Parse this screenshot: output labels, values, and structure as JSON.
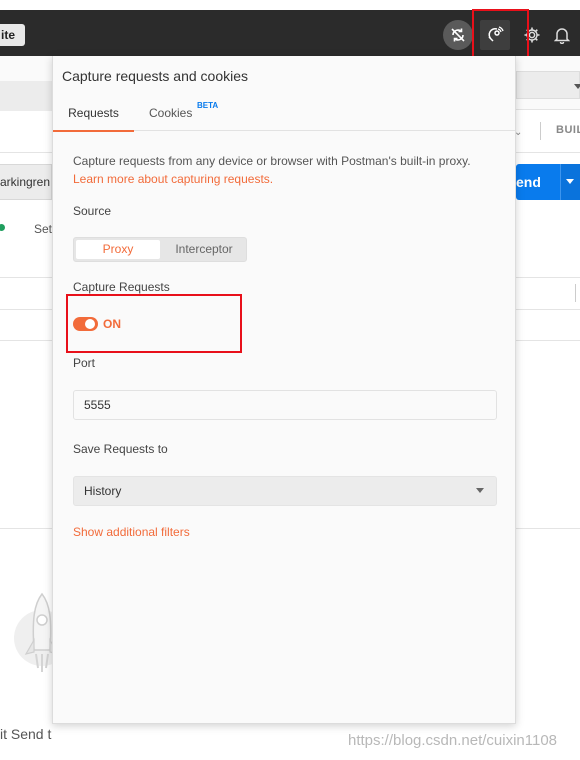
{
  "topbar": {
    "invite_label": "ite"
  },
  "icons": {
    "sync": "sync-off-icon",
    "capture": "satellite-capture-icon",
    "settings": "gear-icon",
    "notifications": "bell-icon"
  },
  "background": {
    "build_label": "BUIL",
    "url_fragment": "arkingren",
    "send_label": "end",
    "settings_fragment": "Set",
    "hit_send_fragment": "it Send t"
  },
  "popover": {
    "title": "Capture requests and cookies",
    "tabs": {
      "requests": "Requests",
      "cookies": "Cookies",
      "beta": "BETA"
    },
    "description": "Capture requests from any device or browser with Postman's built-in proxy.",
    "learn_more": "Learn more about capturing requests.",
    "source_label": "Source",
    "source_options": {
      "proxy": "Proxy",
      "interceptor": "Interceptor"
    },
    "capture_label": "Capture Requests",
    "capture_state": "ON",
    "port_label": "Port",
    "port_value": "5555",
    "save_label": "Save Requests to",
    "save_value": "History",
    "filters_link": "Show additional filters"
  },
  "watermark": "https://blog.csdn.net/cuixin1108",
  "colors": {
    "accent": "#f26b3a",
    "send_blue": "#097bed",
    "highlight_red": "#e8101a",
    "topbar": "#2b2b2b"
  }
}
